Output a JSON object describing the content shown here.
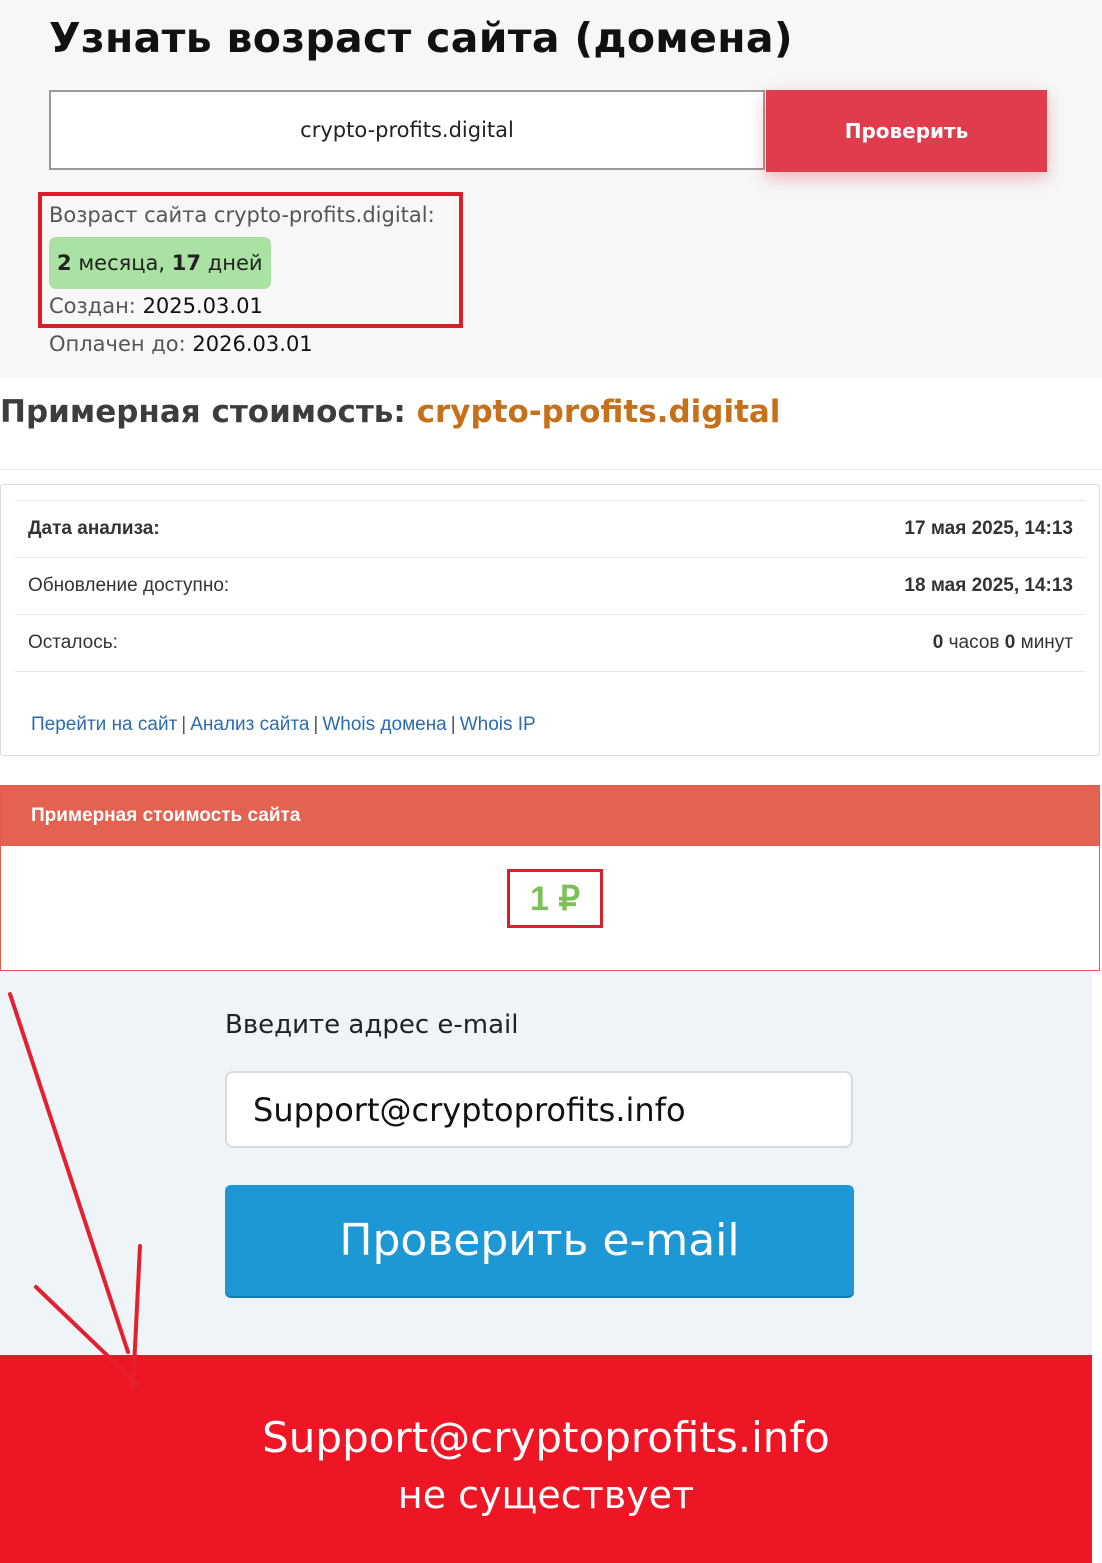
{
  "age_check": {
    "title": "Узнать возраст сайта (домена)",
    "domain_input_value": "crypto-profits.digital",
    "check_button_label": "Проверить",
    "age_label": "Возраст сайта crypto-profits.digital:",
    "age_months": "2",
    "age_months_word": "месяца,",
    "age_days": "17",
    "age_days_word": "дней",
    "created_label": "Создан:",
    "created_value": "2025.03.01",
    "paid_label": "Оплачен до:",
    "paid_value": "2026.03.01"
  },
  "cost": {
    "title_prefix": "Примерная стоимость:",
    "title_domain": "crypto-profits.digital",
    "rows": [
      {
        "label": "Дата анализа:",
        "value": "17 мая 2025, 14:13"
      },
      {
        "label": "Обновление доступно:",
        "value": "18 мая 2025, 14:13"
      },
      {
        "label": "Осталось:",
        "hours": "0",
        "hours_word": "часов",
        "minutes": "0",
        "minutes_word": "минут"
      }
    ],
    "links": [
      "Перейти на сайт",
      "Анализ сайта",
      "Whois домена",
      "Whois IP"
    ],
    "separator": "|",
    "value_card_header": "Примерная стоимость сайта",
    "value": "1 ₽"
  },
  "email_check": {
    "label": "Введите адрес e-mail",
    "input_value": "Support@cryptoprofits.info",
    "button_label": "Проверить e-mail",
    "result_email": "Support@cryptoprofits.info",
    "result_text": "не существует"
  },
  "colors": {
    "check_button": "#e03c4b",
    "highlight_border": "#d81f2a",
    "age_badge": "#a9e2a3",
    "domain_accent": "#c7701a",
    "value_header": "#e36251",
    "value_text": "#7cc05a",
    "email_button": "#1e98d5",
    "result_banner": "#ee1624",
    "annotation_arrow": "#e5202e"
  }
}
